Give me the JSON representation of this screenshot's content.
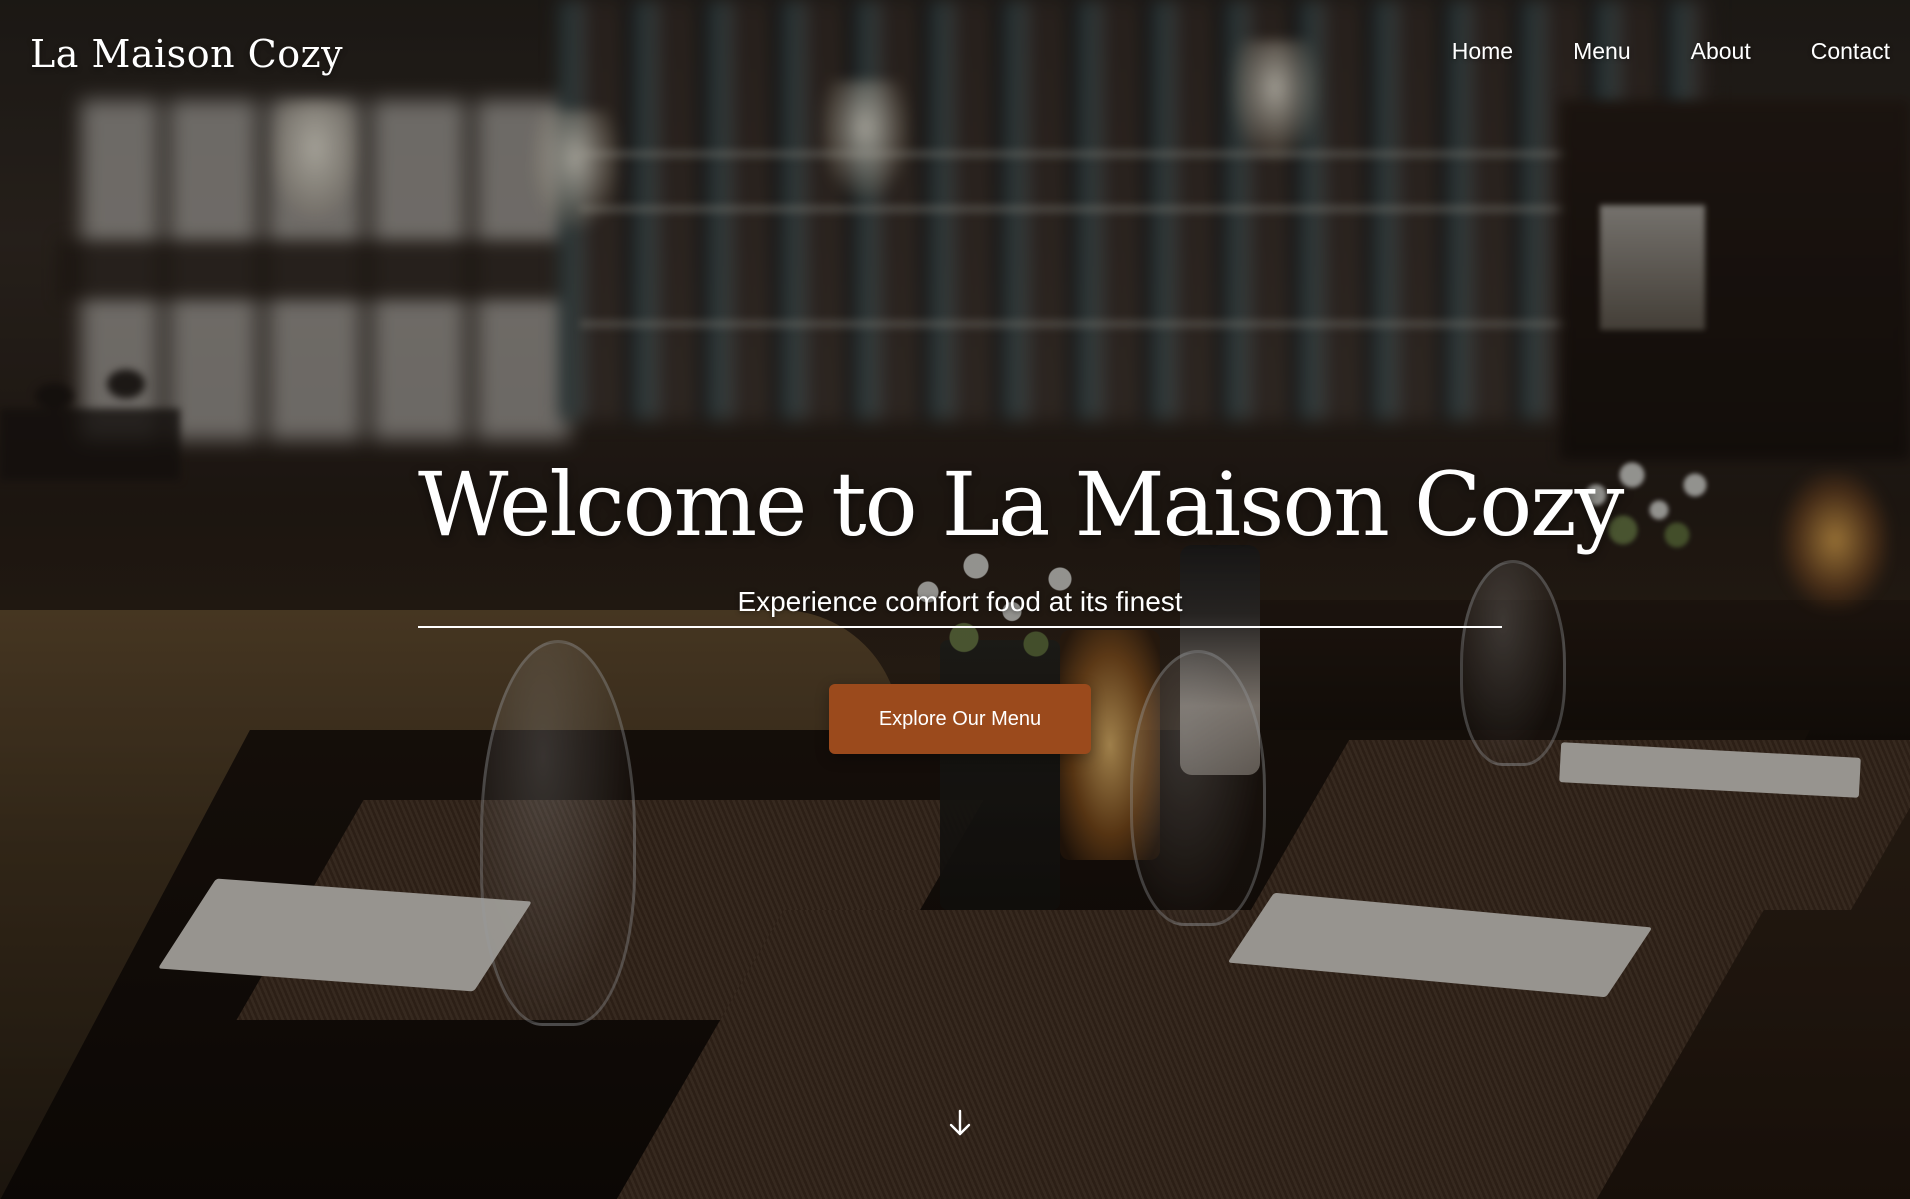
{
  "brand": {
    "name": "La Maison Cozy"
  },
  "nav": {
    "items": [
      {
        "label": "Home"
      },
      {
        "label": "Menu"
      },
      {
        "label": "About"
      },
      {
        "label": "Contact"
      }
    ]
  },
  "hero": {
    "title": "Welcome to La Maison Cozy",
    "subtitle": "Experience comfort food at its finest",
    "cta_label": "Explore Our Menu",
    "scroll_icon": "arrow-down-icon"
  },
  "colors": {
    "accent": "#9b4a1c",
    "text": "#ffffff",
    "overlay": "rgba(0,0,0,0.35)"
  }
}
